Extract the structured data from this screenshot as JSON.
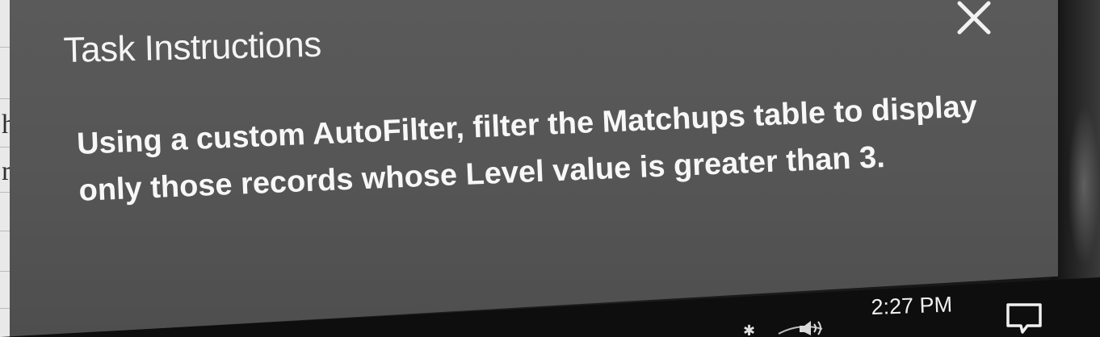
{
  "dialog": {
    "title": "Task Instructions",
    "close_icon": "close-icon",
    "instruction": "Using a custom AutoFilter, filter the Matchups table to display only those records whose Level value is greater than 3."
  },
  "taskbar": {
    "clock": "2:27 PM",
    "bluetooth_icon": "bluetooth-icon",
    "volume_icon": "volume-icon",
    "notification_icon": "notification-icon"
  },
  "colors": {
    "panel_bg": "#555555",
    "panel_text": "#f4f4f4",
    "taskbar_bg": "#0e0e0f"
  }
}
